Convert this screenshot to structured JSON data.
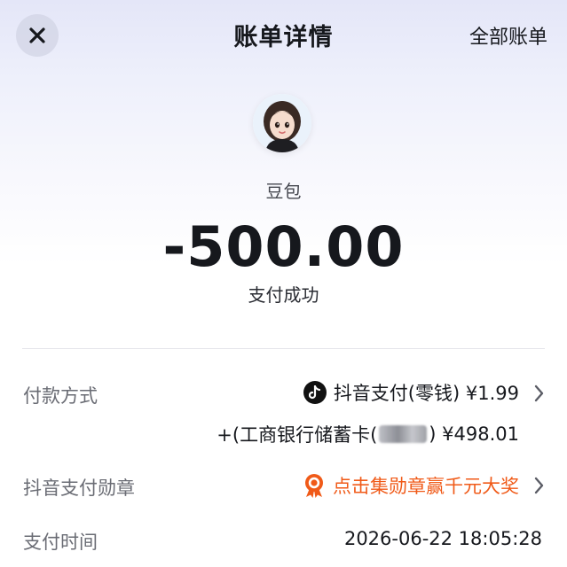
{
  "header": {
    "title": "账单详情",
    "all_bills_label": "全部账单"
  },
  "summary": {
    "merchant": "豆包",
    "amount": "-500.00",
    "status": "支付成功"
  },
  "details": {
    "payment_method": {
      "label": "付款方式",
      "primary": "抖音支付(零钱) ¥1.99",
      "secondary_prefix": "+(工商银行储蓄卡(",
      "secondary_suffix": ") ¥498.01"
    },
    "badge": {
      "label": "抖音支付勋章",
      "value": "点击集勋章赢千元大奖"
    },
    "pay_time": {
      "label": "支付时间",
      "value": "2026-06-22 18:05:28"
    }
  },
  "colors": {
    "accent_orange": "#f05a18",
    "text_primary": "#16181d",
    "text_secondary": "#6a6c74"
  },
  "icons": [
    "close-icon",
    "avatar",
    "douyin-logo-icon",
    "medal-icon",
    "chevron-right-icon"
  ]
}
